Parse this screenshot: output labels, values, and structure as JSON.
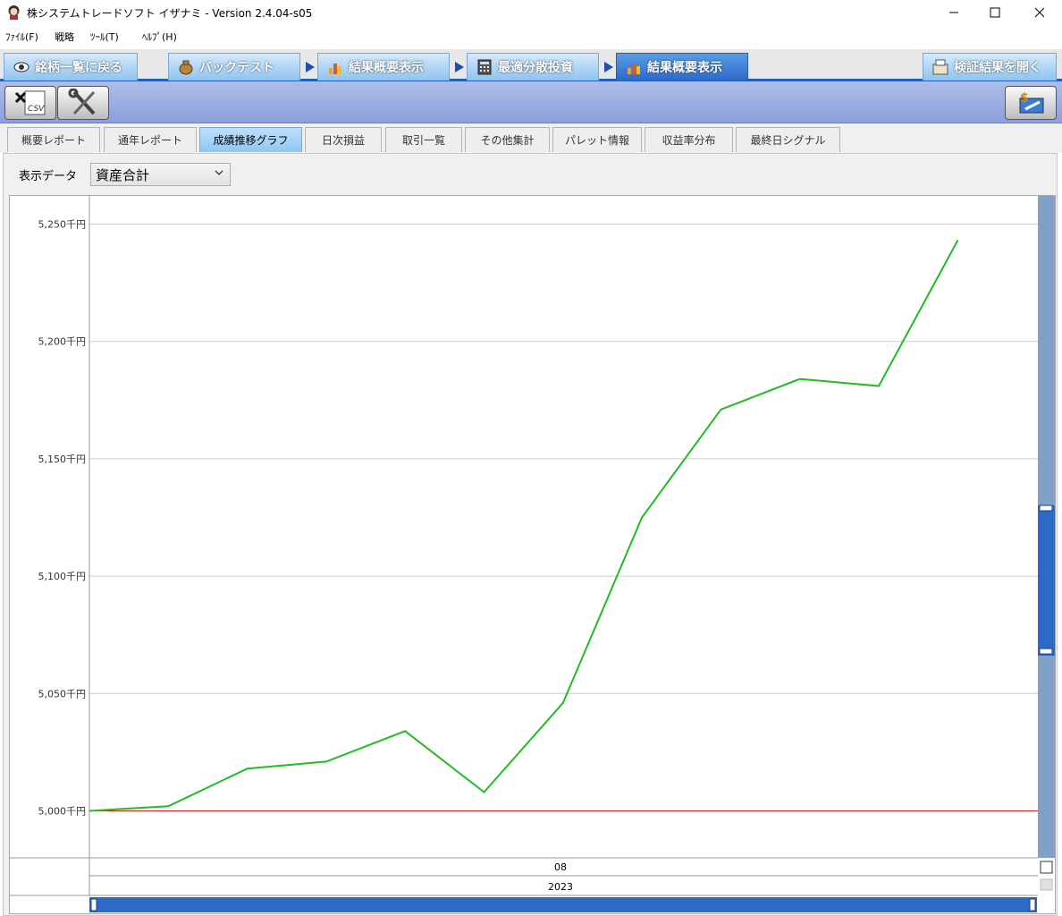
{
  "window": {
    "title": "株システムトレードソフト イザナミ - Version 2.4.04-s05"
  },
  "menu": [
    "ﾌｧｲﾙ(F)",
    "戦略",
    "ﾂｰﾙ(T)",
    "ﾍﾙﾌﾟ(H)"
  ],
  "main_tabs": [
    {
      "label": "銘柄一覧に戻る",
      "icon": "eye-icon"
    },
    {
      "label": "バックテスト",
      "icon": "bag-icon"
    },
    {
      "label": "結果概要表示",
      "icon": "chart-icon"
    },
    {
      "label": "最適分散投資",
      "icon": "calculator-icon"
    },
    {
      "label": "結果概要表示",
      "icon": "chart-icon"
    },
    {
      "label": "検証結果を開く",
      "icon": "open-icon"
    }
  ],
  "sub_tabs": [
    "概要レポート",
    "通年レポート",
    "成績推移グラフ",
    "日次損益",
    "取引一覧",
    "その他集計",
    "パレット情報",
    "収益率分布",
    "最終日シグナル"
  ],
  "active_sub_tab": 2,
  "display": {
    "label": "表示データ",
    "value": "資産合計"
  },
  "colors": {
    "line": "#22bb22",
    "baseline": "#cc2222",
    "accent": "#2d69c8"
  },
  "chart_data": {
    "type": "line",
    "y_unit": "千円",
    "ylim": [
      4980,
      5262
    ],
    "yticks": [
      "5,000千円",
      "5,050千円",
      "5,100千円",
      "5,150千円",
      "5,200千円",
      "5,250千円"
    ],
    "ytick_values": [
      5000,
      5050,
      5100,
      5150,
      5200,
      5250
    ],
    "x_axis_labels": {
      "month": "08",
      "year": "2023"
    },
    "baseline": 5000,
    "values": [
      5000,
      5002,
      5018,
      5021,
      5034,
      5008,
      5046,
      5125,
      5171,
      5184,
      5181,
      5243
    ],
    "grid": true
  }
}
